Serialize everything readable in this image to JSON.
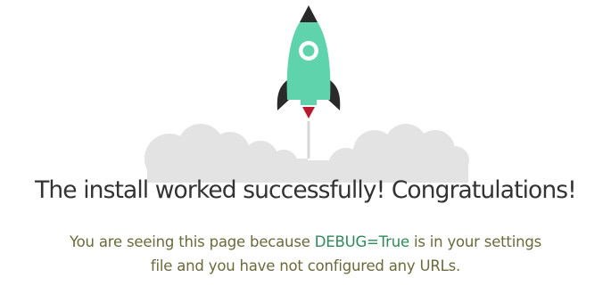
{
  "headline": "The install worked successfully! Congratulations!",
  "message": {
    "before": "You are seeing this page because ",
    "code": "DEBUG=True",
    "after": " is in your settings file and you have not configured any URLs."
  },
  "colors": {
    "rocket_body": "#5ed3ac",
    "rocket_fins": "#2a2a2a",
    "flame": "#b8192e",
    "cloud": "#e3e3e3",
    "headline": "#333333",
    "message": "#6a6a3a",
    "code": "#2e8b57"
  },
  "icons": {
    "rocket": "rocket-icon",
    "clouds": "cloud-icon"
  }
}
